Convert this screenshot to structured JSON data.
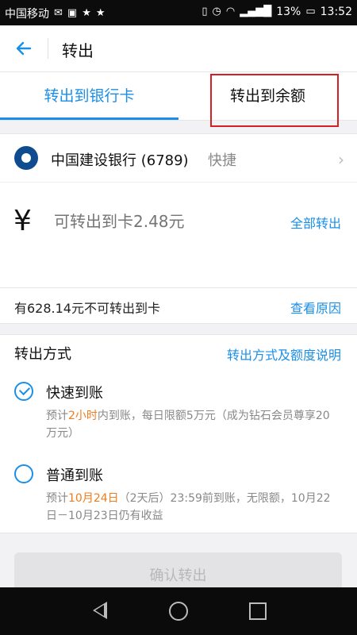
{
  "status_bar": {
    "carrier": "中国移动",
    "battery_percent": "13%",
    "time": "13:52",
    "icons_left": [
      "notification-icon",
      "image-icon",
      "star-icon",
      "star-icon"
    ],
    "icons_right": [
      "vibrate-icon",
      "alarm-icon",
      "wifi-icon",
      "signal-icon",
      "battery-icon"
    ]
  },
  "header": {
    "title": "转出"
  },
  "tabs": [
    {
      "label": "转出到银行卡",
      "active": true
    },
    {
      "label": "转出到余额",
      "active": false
    }
  ],
  "bank": {
    "name": "中国建设银行 (6789)",
    "tag": "快捷"
  },
  "amount": {
    "currency_symbol": "¥",
    "placeholder": "可转出到卡2.48元",
    "all_label": "全部转出"
  },
  "notice": {
    "text": "有628.14元不可转出到卡",
    "link": "查看原因"
  },
  "method": {
    "label": "转出方式",
    "help_link": "转出方式及额度说明",
    "options": [
      {
        "title": "快速到账",
        "selected": true,
        "desc_prefix": "预计",
        "desc_highlight": "2小时",
        "desc_suffix": "内到账，每日限额5万元（成为钻石会员尊享20万元）"
      },
      {
        "title": "普通到账",
        "selected": false,
        "desc_prefix": "预计",
        "desc_highlight": "10月24日",
        "desc_suffix": "（2天后）23:59前到账，无限额，10月22日－10月23日仍有收益"
      }
    ]
  },
  "confirm_button": "确认转出",
  "colors": {
    "accent": "#1b8fe8",
    "highlight": "#f07c1c",
    "annotation_box": "#d81e25"
  }
}
